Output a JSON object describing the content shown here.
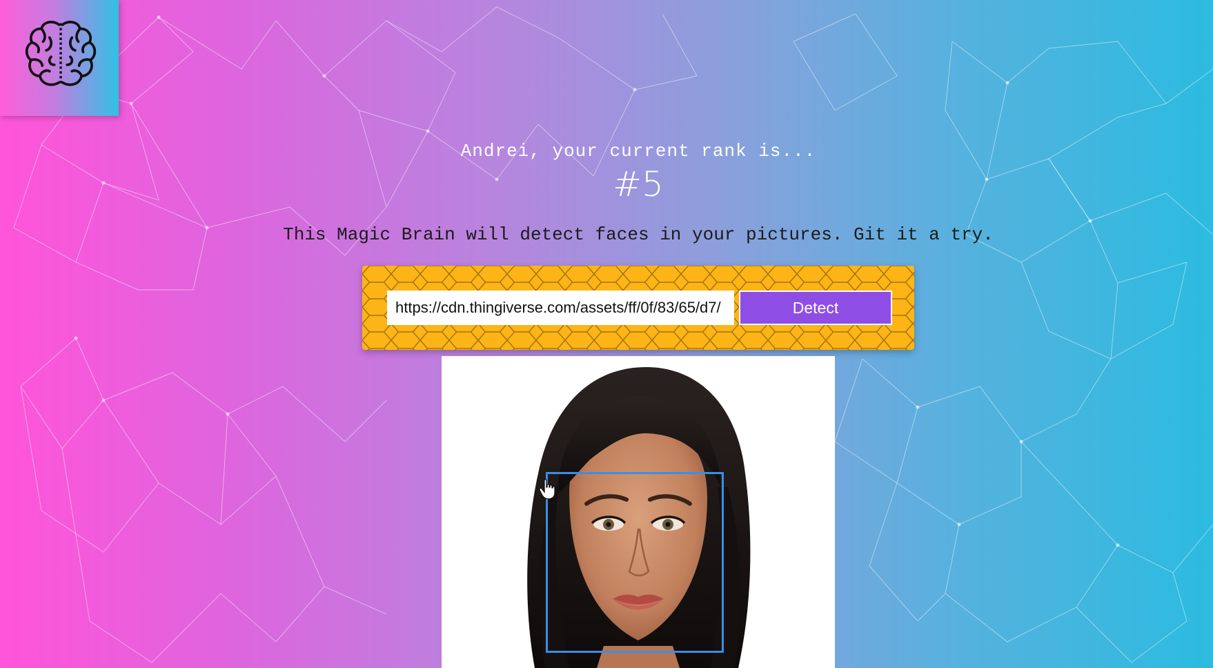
{
  "app": {
    "logo_icon": "brain-icon",
    "accent_colors": {
      "gradient_left": "#ff54d9",
      "gradient_right": "#2cbbe0",
      "panel": "#fdb416",
      "button": "#8e4ee6",
      "face_box": "#3a8ee6"
    }
  },
  "rank": {
    "message": "Andrei, your current rank is...",
    "number": "#5"
  },
  "tagline": "This Magic Brain will detect faces in your pictures. Git it a try.",
  "detect_form": {
    "url_value": "https://cdn.thingiverse.com/assets/ff/0f/83/65/d7/",
    "button_label": "Detect"
  },
  "result": {
    "image_icon": "face-photo",
    "face_box_icon": "face-bounding-box"
  }
}
